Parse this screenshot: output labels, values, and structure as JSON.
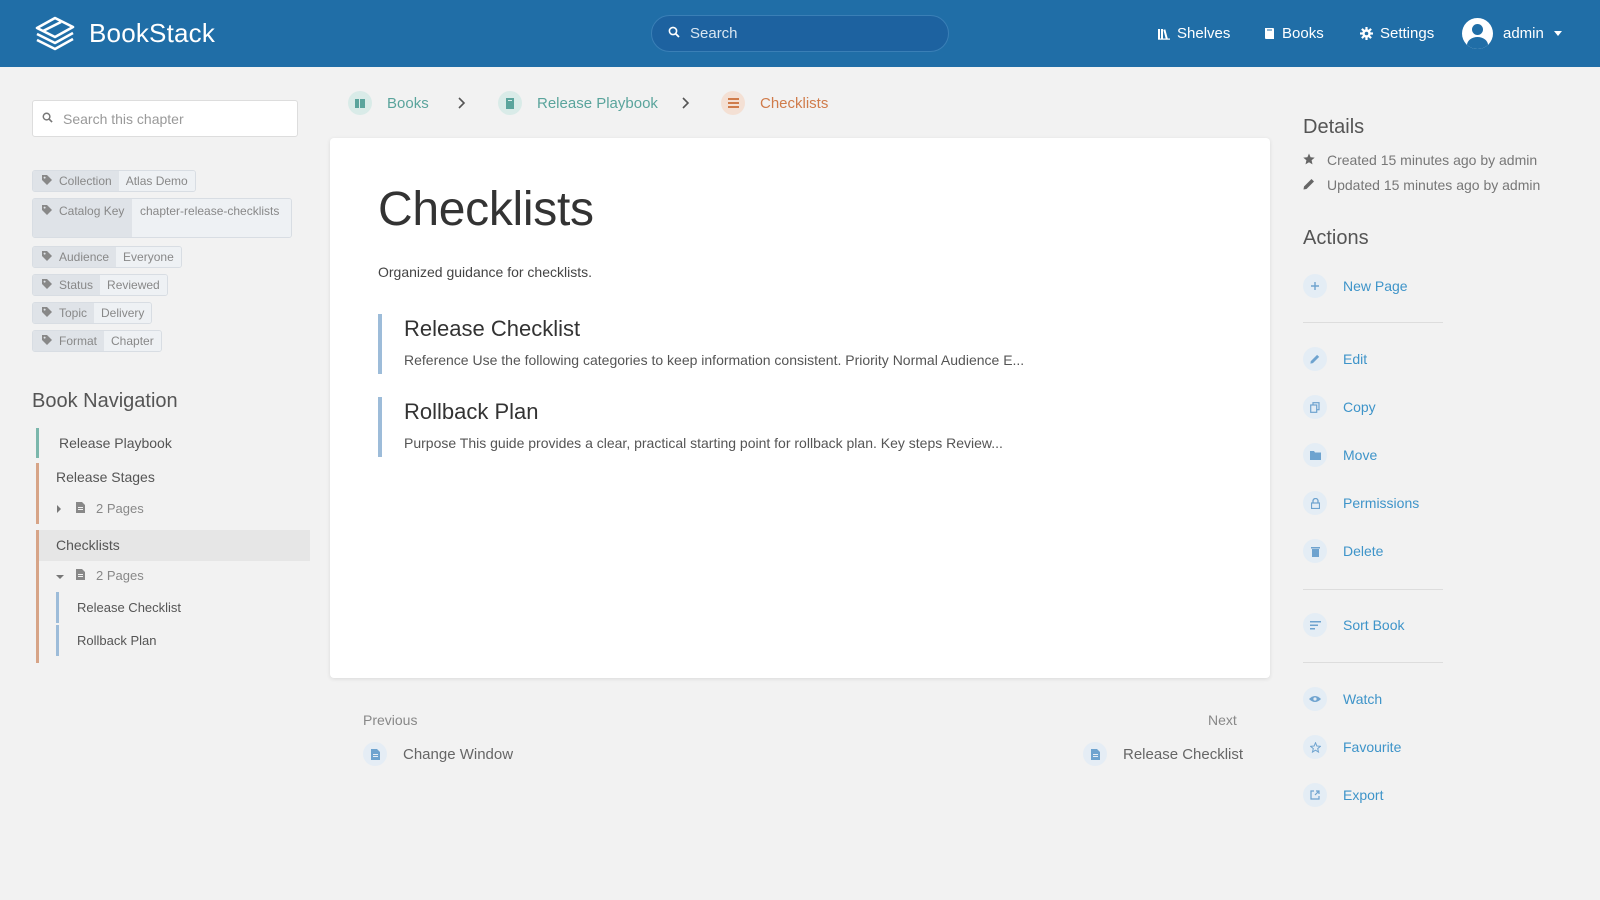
{
  "header": {
    "app_name": "BookStack",
    "search_placeholder": "Search",
    "nav": [
      {
        "label": "Shelves",
        "icon": "shelves-icon"
      },
      {
        "label": "Books",
        "icon": "book-icon"
      },
      {
        "label": "Settings",
        "icon": "gear-icon"
      }
    ],
    "user": "admin"
  },
  "sidebar": {
    "chapter_search_placeholder": "Search this chapter",
    "tags": [
      {
        "name": "Collection",
        "value": "Atlas Demo"
      },
      {
        "name": "Catalog Key",
        "value": "chapter-release-checklists"
      },
      {
        "name": "Audience",
        "value": "Everyone"
      },
      {
        "name": "Status",
        "value": "Reviewed"
      },
      {
        "name": "Topic",
        "value": "Delivery"
      },
      {
        "name": "Format",
        "value": "Chapter"
      }
    ],
    "book_nav_title": "Book Navigation",
    "book_nav": {
      "book": "Release Playbook",
      "chapters": [
        {
          "label": "Release Stages",
          "pages_label": "2 Pages"
        },
        {
          "label": "Checklists",
          "pages_label": "2 Pages",
          "pages": [
            "Release Checklist",
            "Rollback Plan"
          ]
        }
      ]
    }
  },
  "breadcrumb": [
    {
      "label": "Books",
      "color": "#5aa49c"
    },
    {
      "label": "Release Playbook",
      "color": "#5aa49c"
    },
    {
      "label": "Checklists",
      "color": "#d07c4b"
    }
  ],
  "main": {
    "title": "Checklists",
    "description": "Organized guidance for checklists.",
    "entries": [
      {
        "title": "Release Checklist",
        "excerpt": "Reference Use the following categories to keep information consistent. Priority Normal Audience E..."
      },
      {
        "title": "Rollback Plan",
        "excerpt": "Purpose This guide provides a clear, practical starting point for rollback plan. Key steps Review..."
      }
    ]
  },
  "pager": {
    "previous_label": "Previous",
    "previous_link": "Change Window",
    "next_label": "Next",
    "next_link": "Release Checklist"
  },
  "details": {
    "title": "Details",
    "created": "Created 15 minutes ago by admin",
    "updated": "Updated 15 minutes ago by admin"
  },
  "actions": {
    "title": "Actions",
    "items": [
      "New Page",
      "Edit",
      "Copy",
      "Move",
      "Permissions",
      "Delete",
      "Sort Book",
      "Watch",
      "Favourite",
      "Export"
    ]
  },
  "colors": {
    "header_bg": "#206ea7",
    "book_accent": "#5aa49c",
    "chapter_accent": "#d07c4b",
    "page_accent": "#9dbcd9",
    "link": "#3e94c9"
  }
}
